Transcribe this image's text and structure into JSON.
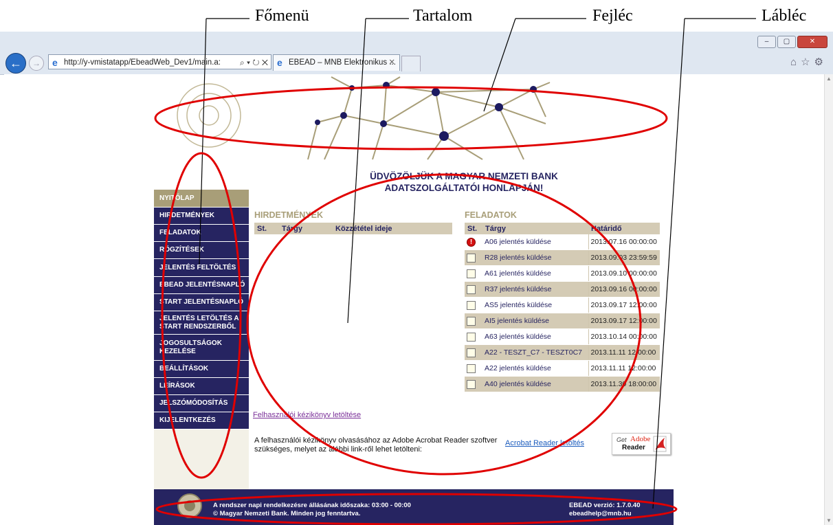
{
  "annotations": {
    "fomenu": "Főmenü",
    "tartalom": "Tartalom",
    "fejlec": "Fejléc",
    "lablec": "Lábléc"
  },
  "browser": {
    "url": "http://y-vmistatapp/EbeadWeb_Dev1/main.a:",
    "tab_title": "EBEAD – MNB Elektronikus ...",
    "address_tools": "⌕ ▾ ↻ ✕",
    "tab_close": "✕",
    "toolbar_icons": "⌂☆⚙",
    "window_buttons": {
      "minimize": "–",
      "maximize": "▢",
      "close": "✕"
    }
  },
  "sidebar": {
    "items": [
      {
        "label": "NYITÓLAP",
        "active": true
      },
      {
        "label": "HIRDETMÉNYEK"
      },
      {
        "label": "FELADATOK"
      },
      {
        "label": "RÖGZÍTÉSEK"
      },
      {
        "label": "JELENTÉS FELTÖLTÉS"
      },
      {
        "label": "EBEAD JELENTÉSNAPLÓ"
      },
      {
        "label": "START JELENTÉSNAPLÓ"
      },
      {
        "label": "JELENTÉS LETÖLTÉS A START RENDSZERBŐL"
      },
      {
        "label": "JOGOSULTSÁGOK KEZELÉSE"
      },
      {
        "label": "BEÁLLÍTÁSOK"
      },
      {
        "label": "LEÍRÁSOK"
      },
      {
        "label": "JELSZÓMÓDOSÍTÁS"
      },
      {
        "label": "KIJELENTKEZÉS"
      }
    ]
  },
  "welcome": {
    "line1": "ÜDVÖZÖLJÜK A MAGYAR NEMZETI BANK",
    "line2": "ADATSZOLGÁLTATÓI HONLAPJÁN!"
  },
  "announcements": {
    "title": "HIRDETMÉNYEK",
    "columns": [
      "St.",
      "Tárgy",
      "Közzététel ideje"
    ]
  },
  "tasks": {
    "title": "FELADATOK",
    "columns": [
      "St.",
      "Tárgy",
      "Határidő"
    ],
    "rows": [
      {
        "status": "warning",
        "subject": "A06 jelentés küldése",
        "deadline": "2013.07.16 00:00:00"
      },
      {
        "status": "doc",
        "subject": "R28 jelentés küldése",
        "deadline": "2013.09.03 23:59:59"
      },
      {
        "status": "doc",
        "subject": "A61 jelentés küldése",
        "deadline": "2013.09.10 00:00:00"
      },
      {
        "status": "doc",
        "subject": "R37 jelentés küldése",
        "deadline": "2013.09.16 00:00:00"
      },
      {
        "status": "doc",
        "subject": "AS5 jelentés küldése",
        "deadline": "2013.09.17 12:00:00"
      },
      {
        "status": "doc",
        "subject": "AI5 jelentés küldése",
        "deadline": "2013.09.17 12:00:00"
      },
      {
        "status": "doc",
        "subject": "A63 jelentés küldése",
        "deadline": "2013.10.14 00:00:00"
      },
      {
        "status": "doc",
        "subject": "A22 - TESZT_C7 - TESZT0C7",
        "deadline": "2013.11.11 12:00:00"
      },
      {
        "status": "doc",
        "subject": "A22 jelentés küldése",
        "deadline": "2013.11.11 12:00:00"
      },
      {
        "status": "doc",
        "subject": "A40 jelentés küldése",
        "deadline": "2013.11.30 18:00:00"
      }
    ]
  },
  "manual": {
    "link": "Felhasználói kézikönyv letöltése",
    "reader_text": "A felhasználói kézikönyv olvasásához az Adobe Acrobat Reader szoftver szükséges, melyet az alábbi link-ről lehet letölteni:",
    "reader_link": "Acrobat Reader letöltés",
    "badge_get": "Get",
    "badge_adobe": "Adobe",
    "badge_reader": "Reader"
  },
  "footer": {
    "availability": "A rendszer napi rendelkezésre állásának időszaka: 03:00 - 00:00",
    "copyright": "© Magyar Nemzeti Bank. Minden jog fenntartva.",
    "version": "EBEAD verzió: 1.7.0.40",
    "email": "ebeadhelp@mnb.hu"
  },
  "colors": {
    "navy": "#262461",
    "gold": "#a89e78",
    "annotation_red": "#e00000"
  }
}
